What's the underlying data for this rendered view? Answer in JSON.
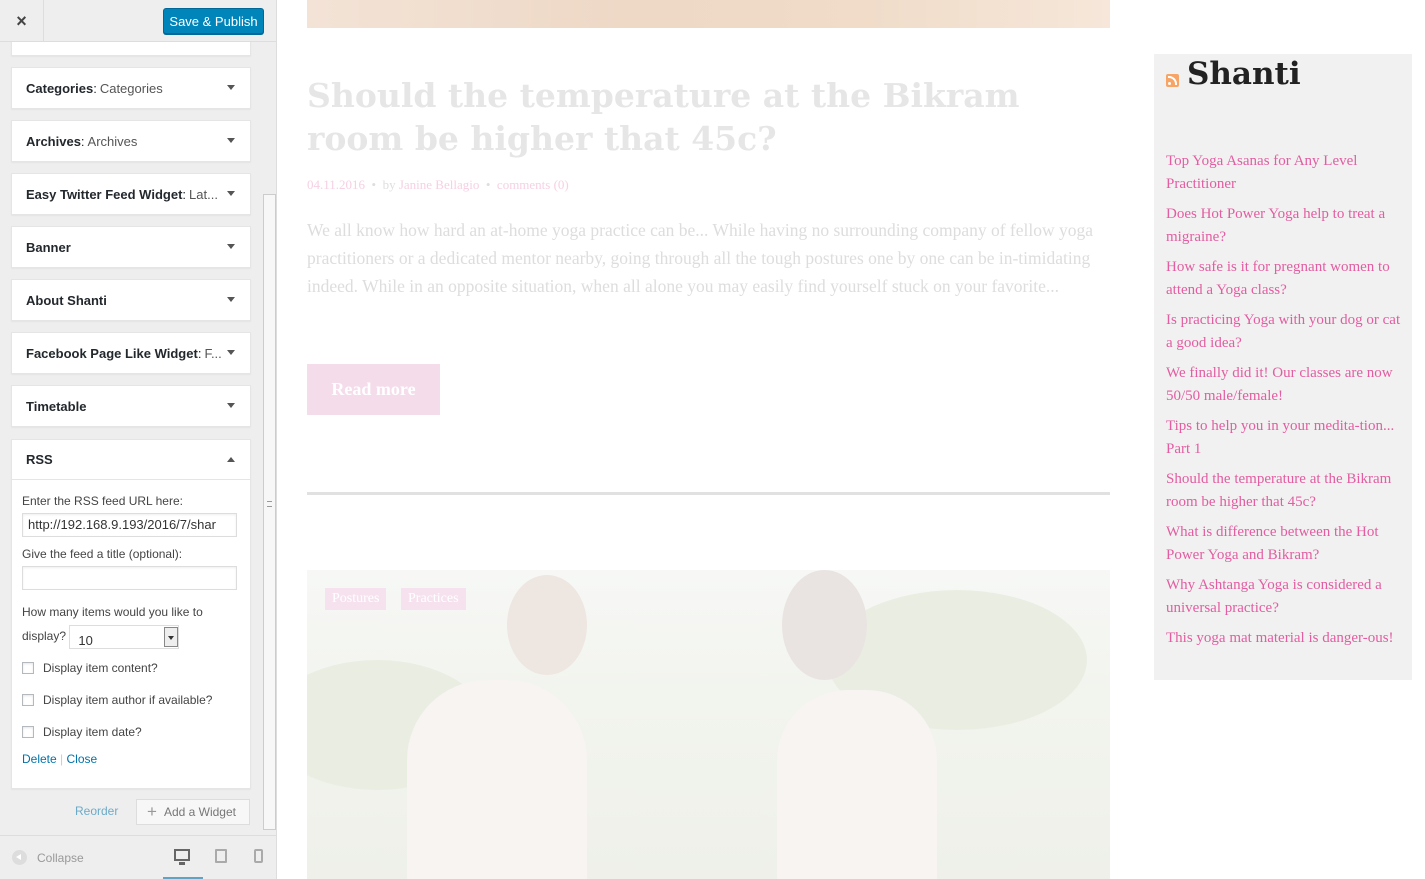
{
  "customizer": {
    "close_label": "×",
    "publish_label": "Save & Publish",
    "widgets": [
      {
        "title": "Categories",
        "subtitle": "Categories"
      },
      {
        "title": "Archives",
        "subtitle": "Archives"
      },
      {
        "title": "Easy Twitter Feed Widget",
        "subtitle": "Lat..."
      },
      {
        "title": "Banner",
        "subtitle": ""
      },
      {
        "title": "About Shanti",
        "subtitle": ""
      },
      {
        "title": "Facebook Page Like Widget",
        "subtitle": "F..."
      },
      {
        "title": "Timetable",
        "subtitle": ""
      }
    ],
    "rss_widget": {
      "title": "RSS",
      "url_label": "Enter the RSS feed URL here:",
      "url_value": "http://192.168.9.193/2016/7/shar",
      "feed_title_label": "Give the feed a title (optional):",
      "feed_title_value": "",
      "items_label_1": "How many items would you like to",
      "items_label_2": "display?",
      "items_value": "10",
      "option_content": "Display item content?",
      "option_author": "Display item author if available?",
      "option_date": "Display item date?",
      "delete_label": "Delete",
      "separator": "|",
      "close_label": "Close"
    },
    "reorder_label": "Reorder",
    "add_widget_label": "Add a Widget",
    "collapse_label": "Collapse"
  },
  "preview": {
    "post": {
      "title": "Should the temperature at the Bikram room be higher that 45c?",
      "date": "04.11.2016",
      "by": "by",
      "author": "Janine Bellagio",
      "comments": "comments (0)",
      "excerpt": "We all know how hard an at-home yoga practice can be... While having no surrounding company of fellow yoga practitioners or a dedicated mentor nearby, going through all the tough postures one by one can be in-timidating indeed. While in an opposite situation, when all alone you may easily find yourself stuck on your favorite...",
      "read_more": "Read more"
    },
    "next_post_tags": [
      "Postures",
      "Practices"
    ],
    "rss_widget": {
      "title": "Shanti",
      "items": [
        "Top Yoga Asanas for Any Level Practitioner",
        "Does Hot Power Yoga help to treat a migraine?",
        "How safe is it for pregnant women to attend a Yoga class?",
        "Is practicing Yoga with your dog or cat a good idea?",
        "We finally did it! Our classes are now 50/50 male/female!",
        "Tips to help you in your medita-tion... Part 1",
        "Should the temperature at the Bikram room be higher that 45c?",
        "What is difference between the Hot Power Yoga and Bikram?",
        "Why Ashtanga Yoga is considered a universal practice?",
        "This yoga mat material is danger-ous!"
      ]
    }
  }
}
